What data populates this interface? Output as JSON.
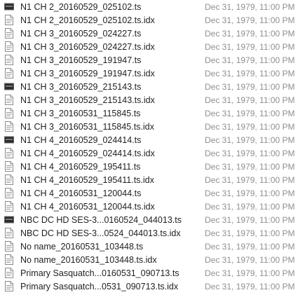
{
  "files": [
    {
      "name": "N1 CH 2_20160529_025102.ts",
      "date": "Dec 31, 1979, 11:00 PM",
      "icon": "video-thumbnail-icon"
    },
    {
      "name": "N1 CH 2_20160529_025102.ts.idx",
      "date": "Dec 31, 1979, 11:00 PM",
      "icon": "document-icon"
    },
    {
      "name": "N1 CH 3_20160529_024227.ts",
      "date": "Dec 31, 1979, 11:00 PM",
      "icon": "document-icon"
    },
    {
      "name": "N1 CH 3_20160529_024227.ts.idx",
      "date": "Dec 31, 1979, 11:00 PM",
      "icon": "document-icon"
    },
    {
      "name": "N1 CH 3_20160529_191947.ts",
      "date": "Dec 31, 1979, 11:00 PM",
      "icon": "document-icon"
    },
    {
      "name": "N1 CH 3_20160529_191947.ts.idx",
      "date": "Dec 31, 1979, 11:00 PM",
      "icon": "document-icon"
    },
    {
      "name": "N1 CH 3_20160529_215143.ts",
      "date": "Dec 31, 1979, 11:00 PM",
      "icon": "video-thumbnail-icon"
    },
    {
      "name": "N1 CH 3_20160529_215143.ts.idx",
      "date": "Dec 31, 1979, 11:00 PM",
      "icon": "document-icon"
    },
    {
      "name": "N1 CH 3_20160531_115845.ts",
      "date": "Dec 31, 1979, 11:00 PM",
      "icon": "document-icon"
    },
    {
      "name": "N1 CH 3_20160531_115845.ts.idx",
      "date": "Dec 31, 1979, 11:00 PM",
      "icon": "document-icon"
    },
    {
      "name": "N1 CH 4_20160529_024414.ts",
      "date": "Dec 31, 1979, 11:00 PM",
      "icon": "video-thumbnail-icon"
    },
    {
      "name": "N1 CH 4_20160529_024414.ts.idx",
      "date": "Dec 31, 1979, 11:00 PM",
      "icon": "document-icon"
    },
    {
      "name": "N1 CH 4_20160529_195411.ts",
      "date": "Dec 31, 1979, 11:00 PM",
      "icon": "document-icon"
    },
    {
      "name": "N1 CH 4_20160529_195411.ts.idx",
      "date": "Dec 31, 1979, 11:00 PM",
      "icon": "document-icon"
    },
    {
      "name": "N1 CH 4_20160531_120044.ts",
      "date": "Dec 31, 1979, 11:00 PM",
      "icon": "document-icon"
    },
    {
      "name": "N1 CH 4_20160531_120044.ts.idx",
      "date": "Dec 31, 1979, 11:00 PM",
      "icon": "document-icon"
    },
    {
      "name": "NBC DC HD SES-3...0160524_044013.ts",
      "date": "Dec 31, 1979, 11:00 PM",
      "icon": "video-thumbnail-icon"
    },
    {
      "name": "NBC DC HD SES-3...0524_044013.ts.idx",
      "date": "Dec 31, 1979, 11:00 PM",
      "icon": "document-icon"
    },
    {
      "name": "No name_20160531_103448.ts",
      "date": "Dec 31, 1979, 11:00 PM",
      "icon": "document-icon"
    },
    {
      "name": "No name_20160531_103448.ts.idx",
      "date": "Dec 31, 1979, 11:00 PM",
      "icon": "document-icon"
    },
    {
      "name": "Primary Sasquatch...0160531_090713.ts",
      "date": "Dec 31, 1979, 11:00 PM",
      "icon": "document-icon"
    },
    {
      "name": "Primary Sasquatch...0531_090713.ts.idx",
      "date": "Dec 31, 1979, 11:00 PM",
      "icon": "document-icon"
    }
  ]
}
